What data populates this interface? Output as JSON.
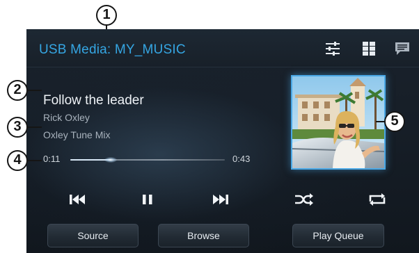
{
  "header": {
    "title": "USB Media: MY_MUSIC",
    "icons": [
      "equalizer-icon",
      "grid-icon",
      "message-icon"
    ]
  },
  "track": {
    "title": "Follow the leader",
    "artist": "Rick Oxley",
    "album": "Oxley Tune Mix"
  },
  "progress": {
    "elapsed": "0:11",
    "total": "0:43",
    "fraction": 0.26
  },
  "controls": [
    "previous-icon",
    "pause-icon",
    "next-icon",
    "shuffle-icon",
    "repeat-icon"
  ],
  "buttons": {
    "source": "Source",
    "browse": "Browse",
    "queue": "Play Queue"
  },
  "callouts": [
    "1",
    "2",
    "3",
    "4",
    "5"
  ],
  "colors": {
    "accent": "#35a6e3",
    "background": "#161e27",
    "text": "#eef2f6"
  }
}
